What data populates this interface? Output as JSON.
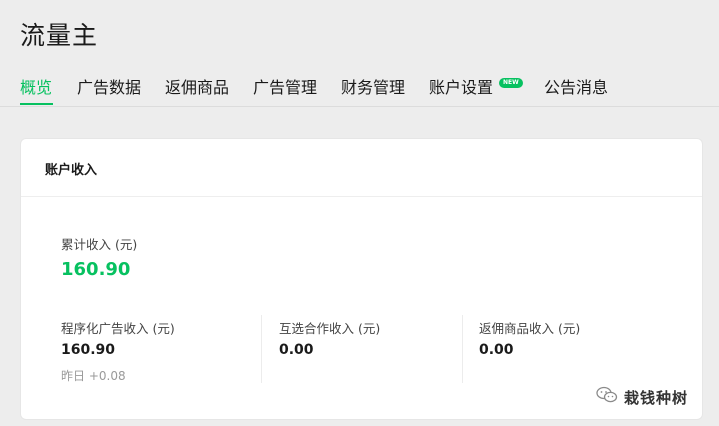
{
  "app_title": "流量主",
  "tabs": [
    {
      "label": "概览",
      "active": true
    },
    {
      "label": "广告数据",
      "active": false
    },
    {
      "label": "返佣商品",
      "active": false
    },
    {
      "label": "广告管理",
      "active": false
    },
    {
      "label": "财务管理",
      "active": false
    },
    {
      "label": "账户设置",
      "active": false,
      "badge": "NEW"
    },
    {
      "label": "公告消息",
      "active": false
    }
  ],
  "card": {
    "title": "账户收入",
    "total": {
      "label": "累计收入 (元)",
      "value": "160.90"
    },
    "breakdown": [
      {
        "label": "程序化广告收入 (元)",
        "value": "160.90",
        "sub": "昨日 +0.08"
      },
      {
        "label": "互选合作收入 (元)",
        "value": "0.00"
      },
      {
        "label": "返佣商品收入 (元)",
        "value": "0.00"
      }
    ]
  },
  "watermark": {
    "icon": "wechat-icon",
    "text": "栽钱种树"
  },
  "colors": {
    "accent": "#07c160",
    "background": "#ededed",
    "card": "#ffffff"
  }
}
